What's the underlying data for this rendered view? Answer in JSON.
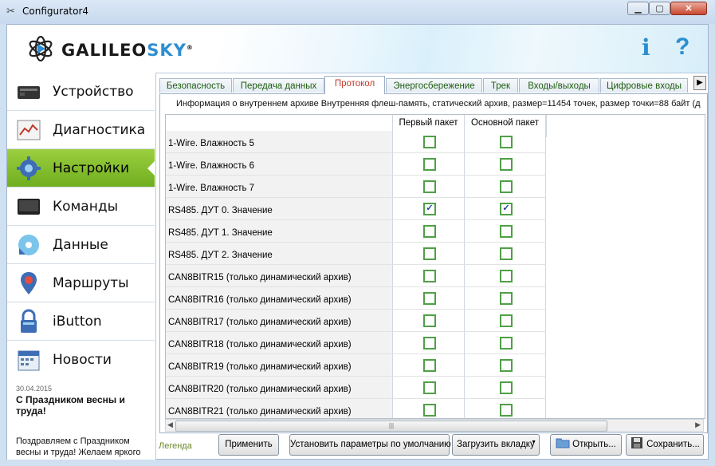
{
  "window": {
    "title": "Configurator4",
    "min_glyph": "▁",
    "max_glyph": "▢",
    "close_glyph": "✕"
  },
  "header": {
    "logo_part1": "GAL",
    "logo_part2": "I",
    "logo_part3": "LEO",
    "logo_part4": "SKY",
    "logo_reg": "®",
    "info_glyph": "i",
    "help_glyph": "?"
  },
  "sidebar": {
    "items": [
      {
        "label": "Устройство",
        "icon": "device-icon"
      },
      {
        "label": "Диагностика",
        "icon": "diagnostics-icon"
      },
      {
        "label": "Настройки",
        "icon": "gear-icon"
      },
      {
        "label": "Команды",
        "icon": "terminal-icon"
      },
      {
        "label": "Данные",
        "icon": "data-icon"
      },
      {
        "label": "Маршруты",
        "icon": "map-pin-icon"
      },
      {
        "label": "iButton",
        "icon": "lock-icon"
      },
      {
        "label": "Новости",
        "icon": "calendar-icon"
      }
    ],
    "active_index": 2,
    "news": {
      "date": "30.04.2015",
      "title": "С Праздником весны и труда!",
      "body": "Поздравляем с Праздником весны и труда! Желаем яркого"
    }
  },
  "tabs": [
    "Безопасность",
    "Передача данных",
    "Протокол",
    "Энергосбережение",
    "Трек",
    "Входы/выходы",
    "Цифровые входы"
  ],
  "active_tab": "Протокол",
  "tab_scroll_glyph": "▶",
  "archive_info": "Информация о внутреннем архиве  Внутренняя флеш-память, статический архив, размер=11454 точек, размер точки=88 байт  (д",
  "table": {
    "columns": [
      "Первый пакет",
      "Основной пакет"
    ],
    "rows": [
      {
        "name": "1-Wire. Влажность 5",
        "first": false,
        "main": false
      },
      {
        "name": "1-Wire. Влажность 6",
        "first": false,
        "main": false
      },
      {
        "name": "1-Wire. Влажность 7",
        "first": false,
        "main": false
      },
      {
        "name": "RS485. ДУТ 0. Значение",
        "first": true,
        "main": true
      },
      {
        "name": "RS485. ДУТ 1. Значение",
        "first": false,
        "main": false
      },
      {
        "name": "RS485. ДУТ 2. Значение",
        "first": false,
        "main": false
      },
      {
        "name": "CAN8BITR15 (только динамический архив)",
        "first": false,
        "main": false
      },
      {
        "name": "CAN8BITR16 (только динамический архив)",
        "first": false,
        "main": false
      },
      {
        "name": "CAN8BITR17 (только динамический архив)",
        "first": false,
        "main": false
      },
      {
        "name": "CAN8BITR18 (только динамический архив)",
        "first": false,
        "main": false
      },
      {
        "name": "CAN8BITR19 (только динамический архив)",
        "first": false,
        "main": false
      },
      {
        "name": "CAN8BITR20 (только динамический архив)",
        "first": false,
        "main": false
      },
      {
        "name": "CAN8BITR21 (только динамический архив)",
        "first": false,
        "main": false
      }
    ],
    "check_glyph": "✓",
    "scroll_left": "◀",
    "scroll_right": "▶",
    "scroll_grip": "|||"
  },
  "footer": {
    "legend": "Легенда",
    "apply": "Применить",
    "defaults": "Установить параметры по умолчанию",
    "load_tab": "Загрузить вкладку",
    "load_caret": "▼",
    "open": "Открыть...",
    "save": "Сохранить..."
  },
  "colors": {
    "accent_green": "#7cbf2a",
    "checkbox_border": "#4fa046",
    "tab_text": "#1f5e0f",
    "active_tab_text": "#c0392b",
    "brand_blue": "#2e8ed1"
  }
}
